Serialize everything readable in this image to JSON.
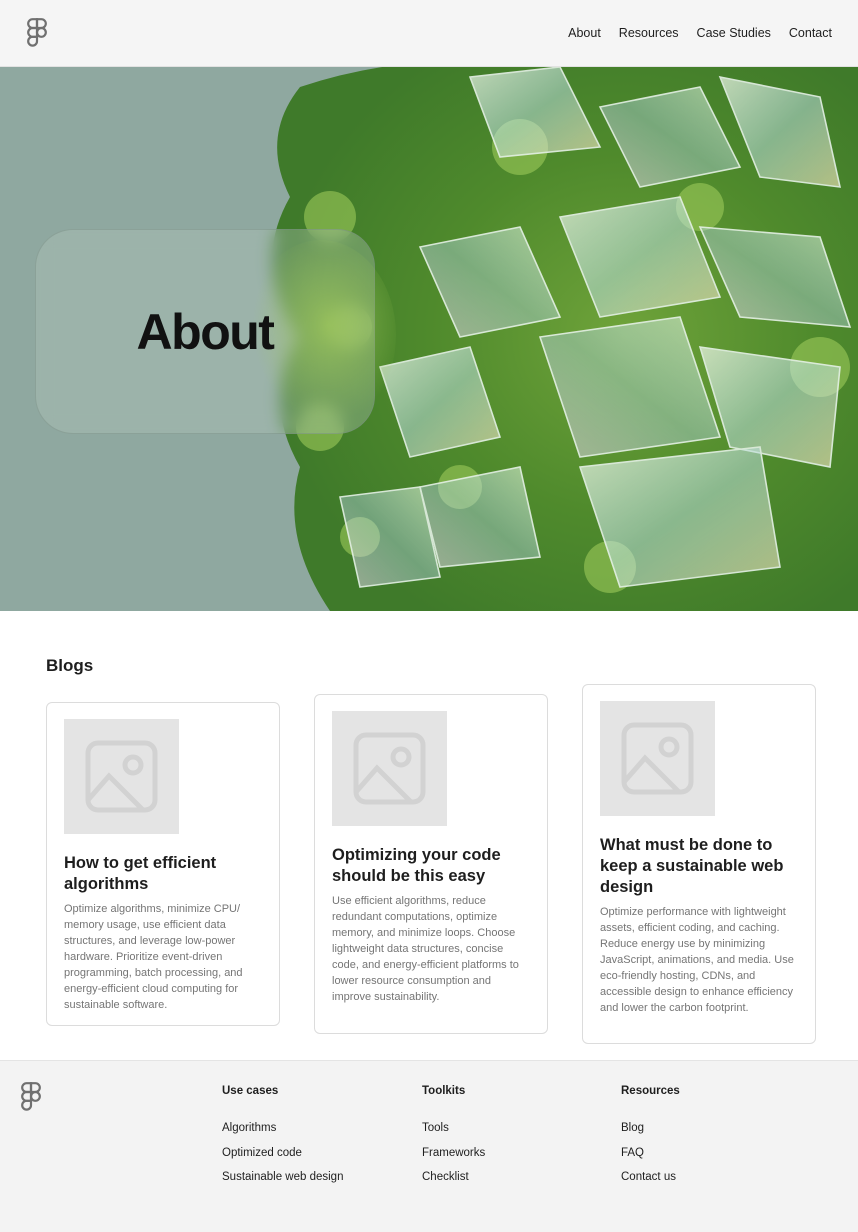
{
  "header": {
    "logo_icon": "figma-logo-icon",
    "nav": [
      {
        "label": "About"
      },
      {
        "label": "Resources"
      },
      {
        "label": "Case Studies"
      },
      {
        "label": "Contact"
      }
    ]
  },
  "hero": {
    "title": "About",
    "background_color": "#8fa8a0"
  },
  "blogs": {
    "heading": "Blogs",
    "cards": [
      {
        "image_icon": "image-placeholder-icon",
        "title": "How to get efficient algorithms",
        "body": "Optimize algorithms, minimize CPU/ memory usage, use efficient data structures, and leverage low-power hardware. Prioritize event-driven programming, batch processing, and energy-efficient cloud computing for sustainable software."
      },
      {
        "image_icon": "image-placeholder-icon",
        "title": "Optimizing your code should be this easy",
        "body": "Use efficient algorithms, reduce redundant computations, optimize memory, and minimize loops. Choose lightweight data structures, concise code, and energy-efficient platforms to lower resource consumption and improve sustainability."
      },
      {
        "image_icon": "image-placeholder-icon",
        "title": "What must be done to keep a sustainable web design",
        "body": "Optimize performance with lightweight assets, efficient coding, and caching. Reduce energy use by minimizing JavaScript, animations, and media. Use eco-friendly hosting, CDNs, and accessible design to enhance efficiency and lower the carbon footprint."
      }
    ]
  },
  "footer": {
    "logo_icon": "figma-logo-icon",
    "columns": [
      {
        "title": "Use cases",
        "items": [
          "Algorithms",
          "Optimized code",
          "Sustainable web design"
        ]
      },
      {
        "title": "Toolkits",
        "items": [
          "Tools",
          "Frameworks",
          "Checklist"
        ]
      },
      {
        "title": "Resources",
        "items": [
          "Blog",
          "FAQ",
          "Contact us"
        ]
      }
    ]
  }
}
